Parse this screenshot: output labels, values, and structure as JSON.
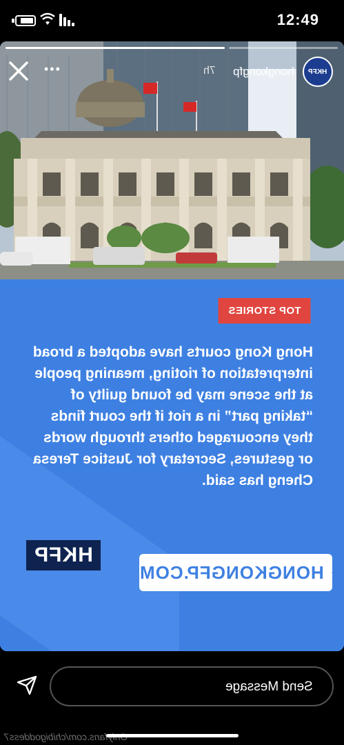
{
  "status_bar": {
    "time": "12:49"
  },
  "story": {
    "username": "hongkongfp",
    "time_ago": "7h",
    "avatar_text": "HKFP",
    "progress": [
      {
        "fill": 1.0
      },
      {
        "fill": 0.0
      }
    ],
    "tag": "TOP STORIES",
    "body": "Hong Kong courts have adopted a broad interpretation of rioting, meaning people at the scene may be found guilty of “taking part” in a riot if the court finds they encouraged others through words or gestures, Secretary for Justice Teresa Cheng has said.",
    "brand_badge": "HKFP",
    "link_text": "HONGKONGFP.COM"
  },
  "composer": {
    "placeholder": "Send Message"
  },
  "watermark": "Onlyfans.com/chibigoddess7",
  "colors": {
    "story_blue": "#3e80e2",
    "tag_red": "#e0463f",
    "badge_navy": "#0e2350"
  },
  "icons": {
    "close": "close-icon",
    "more": "more-icon",
    "send": "send-icon",
    "link": "link-icon"
  }
}
